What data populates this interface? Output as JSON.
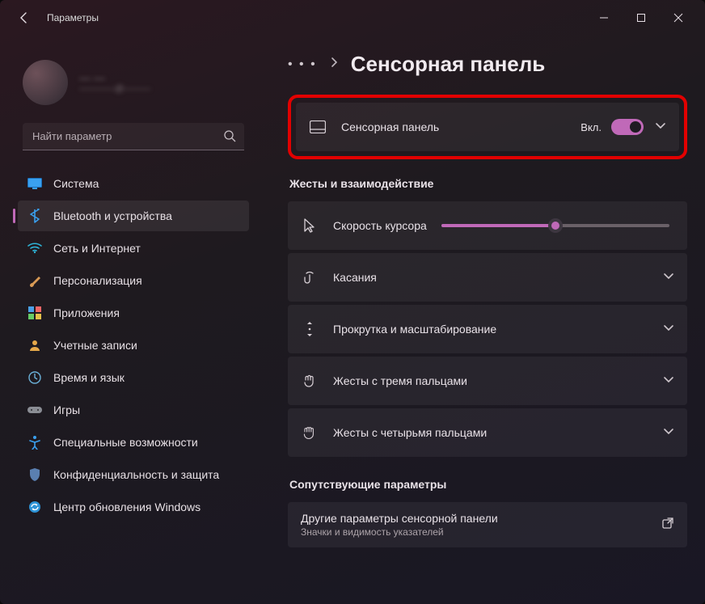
{
  "window": {
    "title": "Параметры"
  },
  "user": {
    "name": "— —",
    "email": "————@———"
  },
  "search": {
    "placeholder": "Найти параметр"
  },
  "sidebar": {
    "items": [
      {
        "label": "Система"
      },
      {
        "label": "Bluetooth и устройства"
      },
      {
        "label": "Сеть и Интернет"
      },
      {
        "label": "Персонализация"
      },
      {
        "label": "Приложения"
      },
      {
        "label": "Учетные записи"
      },
      {
        "label": "Время и язык"
      },
      {
        "label": "Игры"
      },
      {
        "label": "Специальные возможности"
      },
      {
        "label": "Конфиденциальность и защита"
      },
      {
        "label": "Центр обновления Windows"
      }
    ],
    "active_index": 1
  },
  "breadcrumb": {
    "ellipsis": "• • •",
    "title": "Сенсорная панель"
  },
  "touchpad_tile": {
    "label": "Сенсорная панель",
    "state": "Вкл."
  },
  "sections": {
    "gestures_title": "Жесты и взаимодействие",
    "related_title": "Сопутствующие параметры"
  },
  "gesture_tiles": [
    {
      "label": "Скорость курсора",
      "kind": "slider",
      "value": 50
    },
    {
      "label": "Касания",
      "kind": "expand"
    },
    {
      "label": "Прокрутка и масштабирование",
      "kind": "expand"
    },
    {
      "label": "Жесты с тремя пальцами",
      "kind": "expand"
    },
    {
      "label": "Жесты с четырьмя пальцами",
      "kind": "expand"
    }
  ],
  "related": {
    "title": "Другие параметры сенсорной панели",
    "subtitle": "Значки и видимость указателей"
  }
}
